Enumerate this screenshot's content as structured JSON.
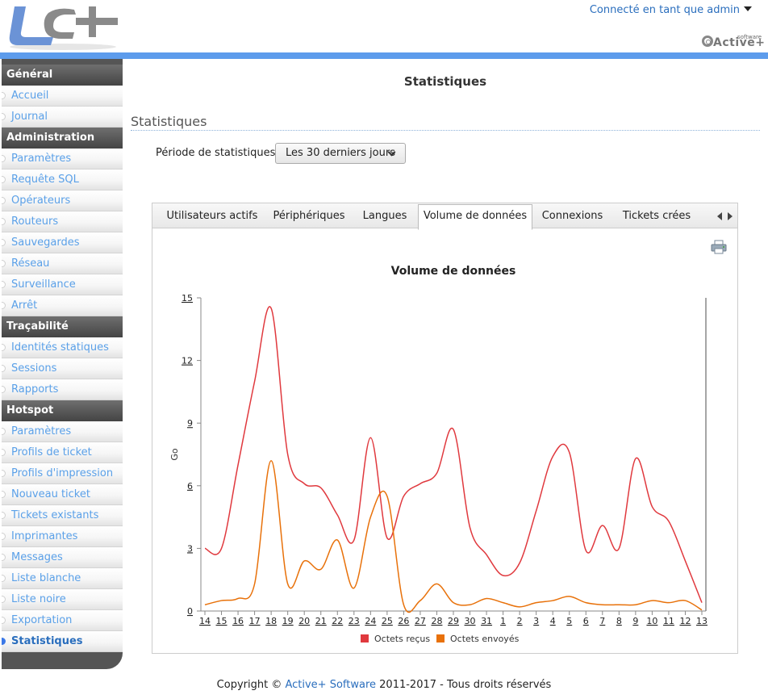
{
  "header": {
    "logo_text": "LC+",
    "user_menu": "Connecté en tant que admin",
    "brand_small": "software",
    "brand_name": "Active+"
  },
  "sidebar": {
    "sections": [
      {
        "title": "Général",
        "items": [
          "Accueil",
          "Journal"
        ]
      },
      {
        "title": "Administration",
        "items": [
          "Paramètres",
          "Requête SQL",
          "Opérateurs",
          "Routeurs",
          "Sauvegardes",
          "Réseau",
          "Surveillance",
          "Arrêt"
        ]
      },
      {
        "title": "Traçabilité",
        "items": [
          "Identités statiques",
          "Sessions",
          "Rapports"
        ]
      },
      {
        "title": "Hotspot",
        "items": [
          "Paramètres",
          "Profils de ticket",
          "Profils d'impression",
          "Nouveau ticket",
          "Tickets existants",
          "Imprimantes",
          "Messages",
          "Liste blanche",
          "Liste noire",
          "Exportation",
          "Statistiques"
        ]
      }
    ],
    "active_item": "Statistiques"
  },
  "main": {
    "page_title": "Statistiques",
    "section_title": "Statistiques",
    "period_label": "Période de statistiques :",
    "period_selected": "Les 30 derniers jours",
    "tabs": [
      "Utilisateurs actifs",
      "Périphériques",
      "Langues",
      "Volume de données",
      "Connexions",
      "Tickets crées"
    ],
    "active_tab": "Volume de données"
  },
  "colors": {
    "accent": "#5d9cec",
    "link": "#2a6ebd",
    "received": "#e0393e",
    "sent": "#e8710a"
  },
  "chart_data": {
    "type": "line",
    "title": "Volume de données",
    "ylabel": "Go",
    "xlabel": "",
    "ylim": [
      0,
      15
    ],
    "yticks": [
      0,
      3,
      6,
      9,
      12,
      15
    ],
    "categories": [
      "14",
      "15",
      "16",
      "17",
      "18",
      "19",
      "20",
      "21",
      "22",
      "23",
      "24",
      "25",
      "26",
      "27",
      "28",
      "29",
      "30",
      "31",
      "1",
      "2",
      "3",
      "4",
      "5",
      "6",
      "7",
      "8",
      "9",
      "10",
      "11",
      "12",
      "13"
    ],
    "series": [
      {
        "name": "Octets reçus",
        "color": "#e0393e",
        "values": [
          3.0,
          3.0,
          7.0,
          11.0,
          14.5,
          7.5,
          6.1,
          5.9,
          4.6,
          3.4,
          8.3,
          3.5,
          5.5,
          6.1,
          6.6,
          8.7,
          4.0,
          2.7,
          1.7,
          2.3,
          4.8,
          7.4,
          7.6,
          2.9,
          4.1,
          3.0,
          7.3,
          5.0,
          4.3,
          2.4,
          0.4
        ]
      },
      {
        "name": "Octets envoyés",
        "color": "#e8710a",
        "values": [
          0.3,
          0.5,
          0.6,
          1.3,
          7.2,
          1.3,
          2.4,
          2.0,
          3.4,
          1.1,
          4.5,
          5.5,
          0.3,
          0.5,
          1.3,
          0.4,
          0.3,
          0.6,
          0.4,
          0.2,
          0.4,
          0.5,
          0.7,
          0.4,
          0.3,
          0.3,
          0.3,
          0.5,
          0.4,
          0.5,
          0.05
        ]
      }
    ],
    "grid": false,
    "legend_position": "bottom"
  },
  "footer": {
    "prefix": "Copyright © ",
    "link": "Active+ Software",
    "suffix": " 2011-2017 - Tous droits réservés"
  }
}
